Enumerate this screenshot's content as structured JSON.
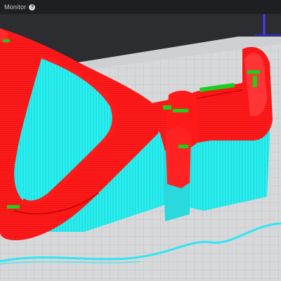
{
  "app": {
    "panel_title": "Monitor",
    "help_icon": "help-icon"
  },
  "scene": {
    "view": "3d-slice-preview",
    "colors": {
      "background": "#2b2d30",
      "bed": "#d7d8da",
      "bed_grid": "#b9bbbf",
      "perimeter": "#ff1a1a",
      "support": "#29f0f0",
      "infill": "#1bd11b",
      "travel_line": "#2fe6f2",
      "axis_blue": "#4a3dff"
    }
  }
}
